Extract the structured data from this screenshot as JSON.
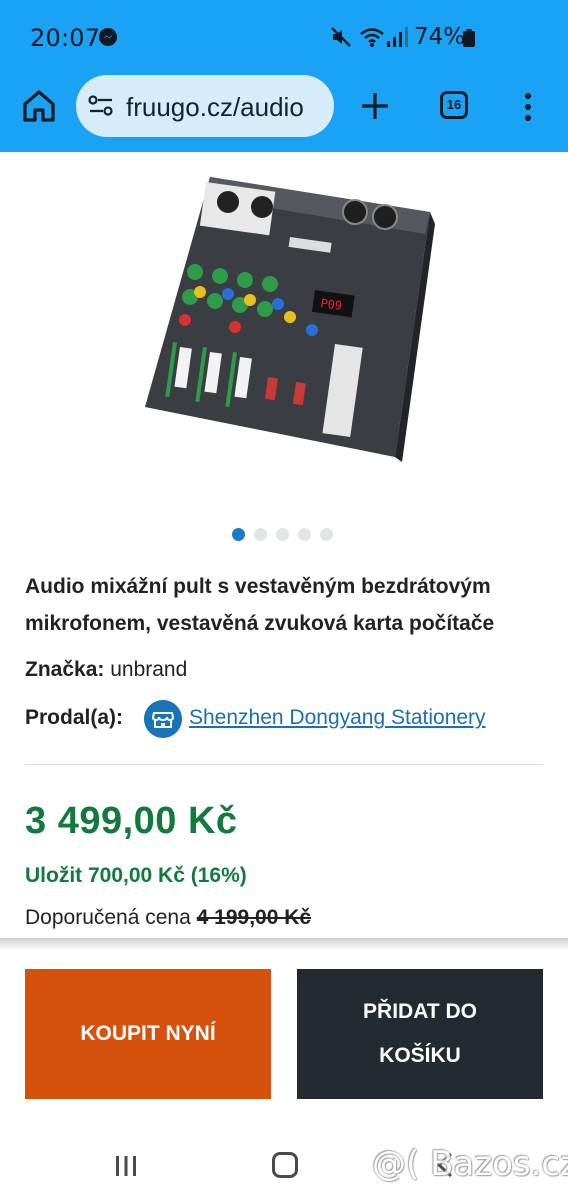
{
  "status_bar": {
    "time": "20:07",
    "battery": "74%"
  },
  "browser": {
    "url": "fruugo.cz/audio",
    "tab_count": "16"
  },
  "product": {
    "image_alt": "audio mixer",
    "gallery_dots": 5,
    "active_dot": 0,
    "title": "Audio mixážní pult s vestavěným bezdrátovým mikrofonem, vestavěná zvuková karta počítače",
    "brand_label": "Značka:",
    "brand_value": "unbrand",
    "seller_label": "Prodal(a):",
    "seller_name": "Shenzhen Dongyang Stationery",
    "price": "3 499,00 Kč",
    "save": "Uložit 700,00 Kč (16%)",
    "rrp_label": "Doporučená cena",
    "rrp_value": "4 199,00 Kč"
  },
  "actions": {
    "buy_now": "KOUPIT NYNÍ",
    "add_to_cart": "PŘIDAT DO KOŠÍKU"
  },
  "watermark": "@( Bazos.cz",
  "colors": {
    "browser_bar": "#1aa3f4",
    "price_green": "#127a3c",
    "buy_orange": "#d6510c",
    "cart_dark": "#242a31",
    "link_blue": "#1a6fb5"
  }
}
